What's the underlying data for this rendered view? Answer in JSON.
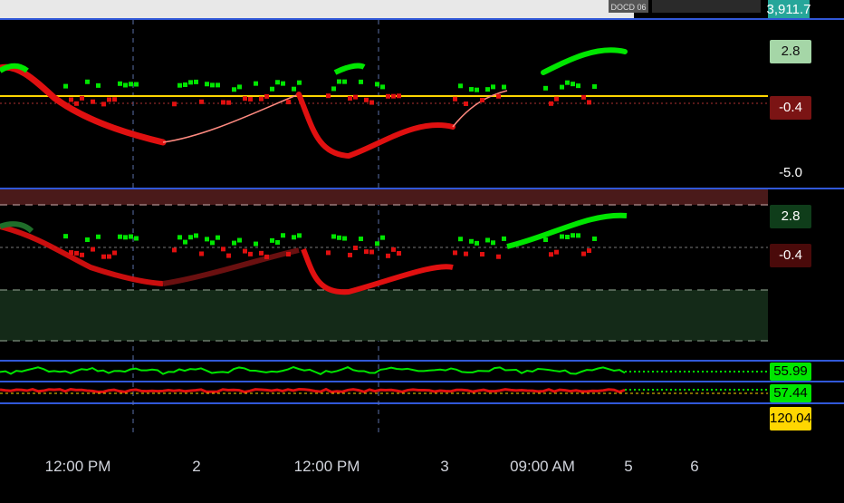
{
  "top_strip": {
    "last_price": "3,911.7",
    "code_tag": "DOCD 06"
  },
  "panes": [
    {
      "id": "upper",
      "level_labels": [
        "2.8",
        "-0.4",
        "-5.0"
      ],
      "label_colors": [
        "#a5d6a7",
        "#7b1414",
        "transparent"
      ],
      "line_color": "#ffd600"
    },
    {
      "id": "lower",
      "level_labels": [
        "2.8",
        "-0.4"
      ],
      "label_colors": [
        "#0f3d1a",
        "#4a0a0a"
      ]
    },
    {
      "id": "oscillators",
      "level_labels": [
        "55.99",
        "57.44",
        "120.04"
      ],
      "label_colors": [
        "#00e600",
        "#00e600",
        "#ffd600"
      ]
    }
  ],
  "x_axis": {
    "labels": [
      "12:00 PM",
      "2",
      "12:00 PM",
      "3",
      "09:00 AM",
      "5",
      "6"
    ]
  },
  "chart_data": {
    "type": "line",
    "x": [
      "12:00 PM",
      "2",
      "12:00 PM",
      "3",
      "09:00 AM",
      "5",
      "6"
    ],
    "series": [
      {
        "values": [
          2.0,
          -2.3,
          -3.4,
          -0.4,
          -4.1,
          -2.2,
          -0.4,
          2.8
        ]
      }
    ],
    "reference_levels": [
      2.8,
      -0.4,
      -5.0
    ],
    "oscillator_values": [
      55.99,
      57.44,
      120.04
    ]
  },
  "colors": {
    "bull": "#00e600",
    "bear": "#e01010",
    "separator": "#3158d8",
    "dashed_vertical": "#5a6fa8"
  }
}
